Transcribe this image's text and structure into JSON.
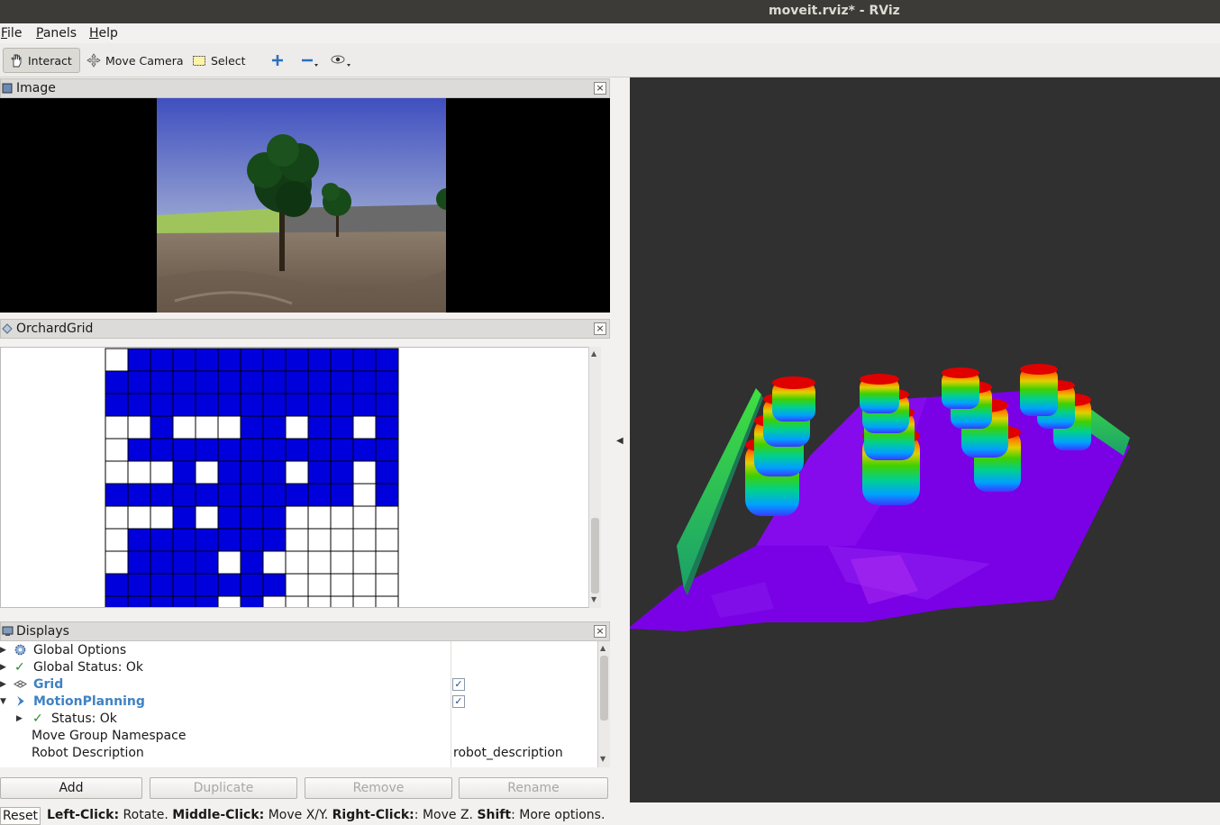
{
  "window": {
    "title": "moveit.rviz* - RViz"
  },
  "menu": {
    "items": [
      {
        "accel": "F",
        "rest": "ile"
      },
      {
        "accel": "P",
        "rest": "anels"
      },
      {
        "accel": "H",
        "rest": "elp"
      }
    ]
  },
  "toolbar": {
    "interact_label": "Interact",
    "move_camera_label": "Move Camera",
    "select_label": "Select",
    "add_tool_icon": "plus-icon",
    "remove_tool_icon": "minus-icon",
    "visibility_icon": "eye-icon"
  },
  "image_panel": {
    "title": "Image"
  },
  "orchard_panel": {
    "title": "OrchardGrid",
    "cell_colors": {
      "filled": "#0000dd",
      "empty": "#ffffff"
    },
    "grid_rows": [
      "0111111111111",
      "1111111111111",
      "1111111111111",
      "0010001101101",
      "0111111111111",
      "0001011101101",
      "1111111111101",
      "0001011100000",
      "0111111100000",
      "0111101000000",
      "1111111100000",
      "1111101000000"
    ]
  },
  "displays_panel": {
    "title": "Displays",
    "rows": [
      {
        "label": "Global Options",
        "value": ""
      },
      {
        "label": "Global Status: Ok",
        "value": ""
      },
      {
        "label": "Grid",
        "value": "✓"
      },
      {
        "label": "MotionPlanning",
        "value": "✓"
      },
      {
        "label": "Status: Ok",
        "value": ""
      },
      {
        "label": "Move Group Namespace",
        "value": ""
      },
      {
        "label": "Robot Description",
        "value": "robot_description"
      }
    ],
    "buttons": {
      "add": "Add",
      "duplicate": "Duplicate",
      "remove": "Remove",
      "rename": "Rename"
    }
  },
  "statusbar": {
    "reset": "Reset",
    "left_click": "Left-Click:",
    "left_action": " Rotate. ",
    "middle_click": "Middle-Click:",
    "middle_action": " Move X/Y. ",
    "right_click": "Right-Click:",
    "right_action": ": Move Z. ",
    "shift": "Shift",
    "shift_action": ": More options."
  }
}
